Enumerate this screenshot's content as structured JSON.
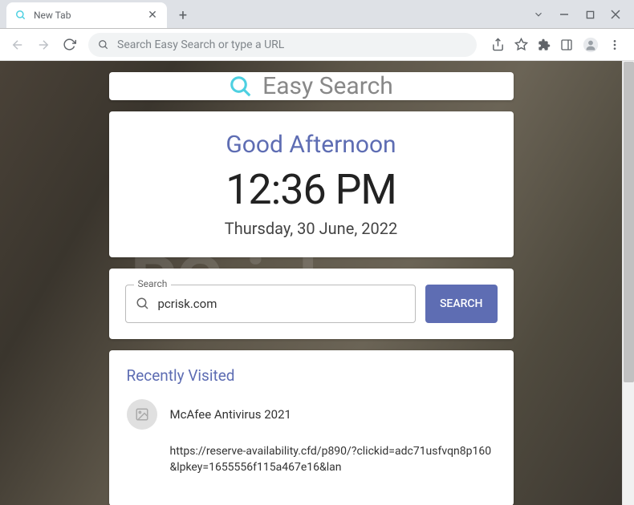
{
  "tab": {
    "title": "New Tab"
  },
  "omnibox": {
    "placeholder": "Search Easy Search or type a URL"
  },
  "logo": {
    "text": "Easy Search"
  },
  "clock": {
    "greeting": "Good Afternoon",
    "time": "12:36 PM",
    "date": "Thursday, 30 June, 2022"
  },
  "search": {
    "label": "Search",
    "value": "pcrisk.com",
    "button": "SEARCH"
  },
  "recent": {
    "title": "Recently Visited",
    "items": [
      {
        "text": "McAfee Antivirus 2021"
      },
      {
        "text": "https://reserve-availability.cfd/p890/?clickid=adc71usfvqn8p160&lpkey=1655556f115a467e16&lan"
      }
    ]
  },
  "watermark": "PCrisk.com"
}
